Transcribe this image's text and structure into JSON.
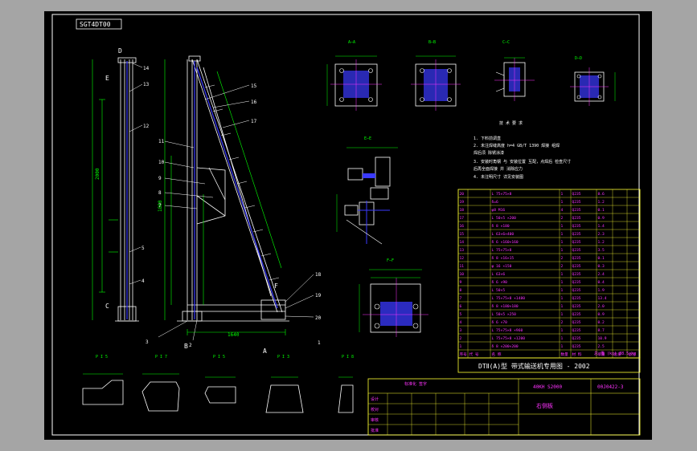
{
  "drawing_code": "0UJ0422-3",
  "sheet_tag": "SGT4DT00",
  "title_block": {
    "series_title": "DTⅡ(A)型 带式输送机专用图 - 2002",
    "model": "40KH S2000",
    "drawing_no": "00J0422-3",
    "part_name": "右侧板",
    "weight_row": "总 重 (kg)  38.5 kg",
    "revision_header": "标准化 签字",
    "rev_rows": [
      "设计",
      "校对",
      "审核",
      "批准"
    ]
  },
  "notes": {
    "heading": "技 术 要 求",
    "items": [
      "1. 下料前调直",
      "2. 未注焊缝高度 h=4 GB/T 1390 焊接 组焊",
      "   焊后须 除锈涂漆",
      "3. 安装时角钢 与 安装位置 互配，点焊后 检查尺寸",
      "   后再全面焊接 并 消除应力",
      "4. 未注明尺寸 详见安装图"
    ]
  },
  "views": {
    "section_labels": [
      "A—A",
      "B—B",
      "C—C",
      "D—D",
      "E—E",
      "F—F"
    ],
    "detail_labels": [
      "P I 5",
      "P I 7",
      "P I 5",
      "P I 3",
      "P I 8"
    ],
    "corner_letters": [
      "D",
      "E",
      "C",
      "B",
      "A",
      "F"
    ],
    "balloons": [
      "1",
      "2",
      "3",
      "4",
      "5",
      "6",
      "7",
      "8",
      "9",
      "10",
      "11",
      "12",
      "13",
      "14",
      "15",
      "16",
      "17",
      "18",
      "19",
      "20"
    ]
  },
  "parts_list": {
    "header": [
      "序号",
      "代 号",
      "名 称",
      "数量",
      "材 料",
      "单重",
      "总重",
      "备注"
    ],
    "rows": [
      [
        "20",
        "",
        "L 75×75×8",
        "1",
        "Q235",
        "8.6",
        "",
        ""
      ],
      [
        "19",
        "",
        "δ=6",
        "1",
        "Q235",
        "1.2",
        "",
        ""
      ],
      [
        "18",
        "",
        "φ8 M16",
        "4",
        "Q235",
        "0.1",
        "",
        ""
      ],
      [
        "17",
        "",
        "L 50×5 ×200",
        "2",
        "Q235",
        "0.9",
        "",
        ""
      ],
      [
        "16",
        "",
        "δ 8 ×180",
        "1",
        "Q235",
        "1.4",
        "",
        ""
      ],
      [
        "15",
        "",
        "L 63×6×400",
        "1",
        "Q235",
        "2.3",
        "",
        ""
      ],
      [
        "14",
        "",
        "δ 6 ×160×160",
        "1",
        "Q235",
        "1.2",
        "",
        ""
      ],
      [
        "13",
        "",
        "L 75×75×8",
        "1",
        "Q235",
        "3.5",
        "",
        ""
      ],
      [
        "12",
        "",
        "δ 8 ×16×15",
        "2",
        "Q235",
        "0.1",
        "",
        ""
      ],
      [
        "11",
        "",
        "φ 16 ×150",
        "2",
        "Q235",
        "0.3",
        "",
        ""
      ],
      [
        "10",
        "",
        "L 63×6",
        "1",
        "Q235",
        "2.4",
        "",
        ""
      ],
      [
        "9",
        "",
        "δ 6 ×90",
        "1",
        "Q235",
        "0.4",
        "",
        ""
      ],
      [
        "8",
        "",
        "L 50×5",
        "1",
        "Q235",
        "1.9",
        "",
        ""
      ],
      [
        "7",
        "",
        "L 75×75×8 ×1480",
        "1",
        "Q235",
        "13.4",
        "",
        ""
      ],
      [
        "6",
        "",
        "δ 8 ×180×180",
        "1",
        "Q235",
        "2.0",
        "",
        ""
      ],
      [
        "5",
        "",
        "L 50×5 ×250",
        "1",
        "Q235",
        "0.9",
        "",
        ""
      ],
      [
        "4",
        "",
        "δ 6 ×70",
        "2",
        "Q235",
        "0.2",
        "",
        ""
      ],
      [
        "3",
        "",
        "L 75×75×8 ×960",
        "1",
        "Q235",
        "8.7",
        "",
        ""
      ],
      [
        "2",
        "",
        "L 75×75×8 ×1200",
        "1",
        "Q235",
        "10.9",
        "",
        ""
      ],
      [
        "1",
        "",
        "δ 8 ×200×200",
        "1",
        "Q235",
        "2.5",
        "",
        ""
      ]
    ]
  },
  "colors": {
    "background": "#a5a5a5",
    "sheet": "#000000",
    "frame": "#ffffff",
    "dimension": "#00ff00",
    "part_line": "#ffffff",
    "accent_blue": "#3a3aff",
    "text_magenta": "#ff33ff",
    "table_line": "#ffff33"
  }
}
